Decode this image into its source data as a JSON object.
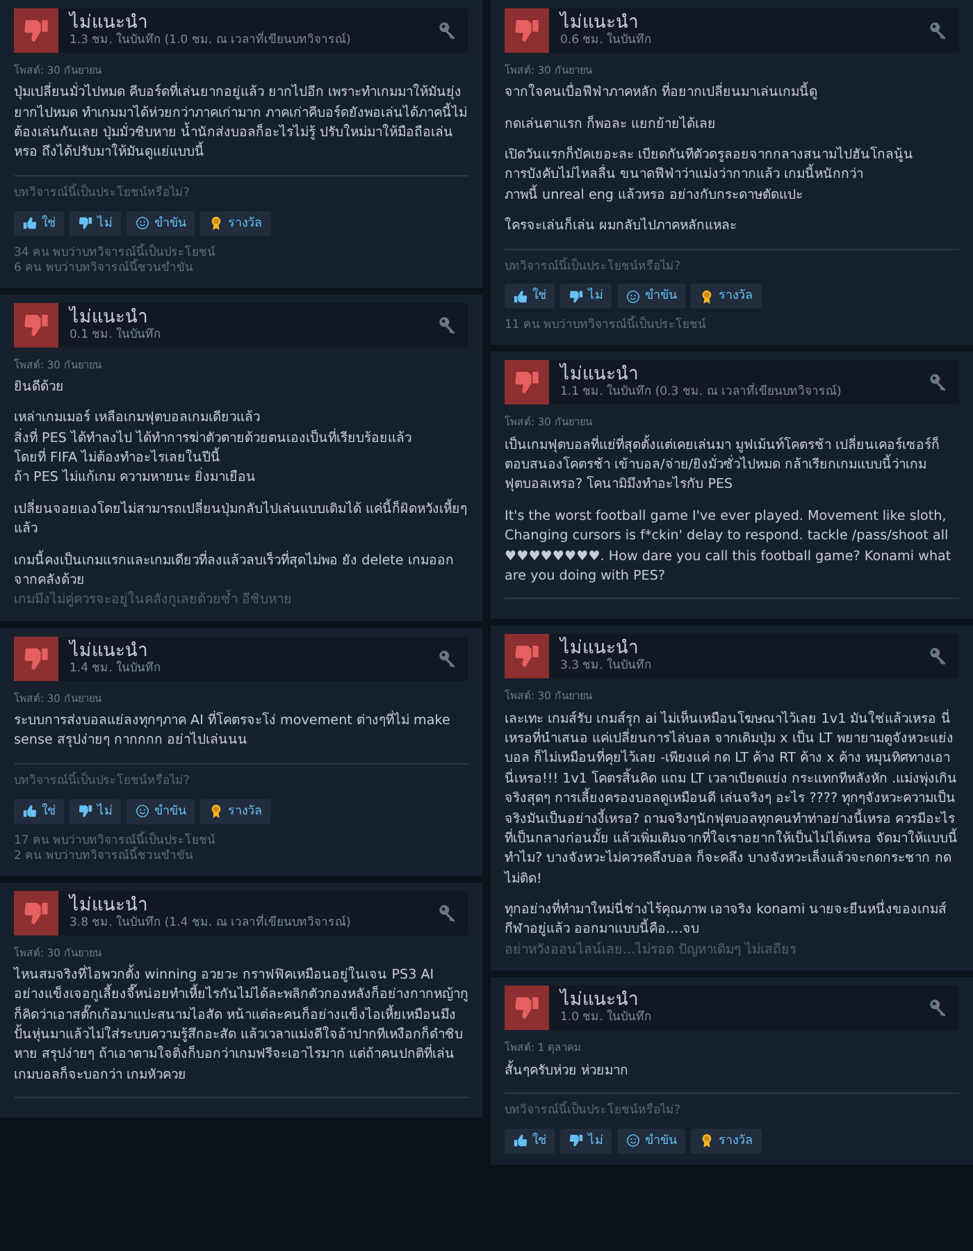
{
  "columns": [
    {
      "reviews": [
        {
          "title": "ไม่แนะนำ",
          "hours": "1.3 ชม. ในบันทึก (1.0 ชม. ณ เวลาที่เขียนบทวิจารณ์)",
          "posted": "โพสต์: 30 กันยายน",
          "paragraphs": [
            "ปุ่มเปลี่ยนมั่วไปหมด คีบอร์ดที่เล่นยากอยู่แล้ว ยากไปอีก เพราะทำเกมมาให้มันยุ่งยากไปหมด ทำเกมมาได้ห่วยกว่าภาคเก่ามาก ภาคเก่าคีบอร์ดยังพอเล่นได้ภาคนี้ไม่ต้องเล่นกันเลย ปุ่มมั่วชิบหาย น้ำนักส่งบอลก็อะไรไม่รู้ ปรับใหม่มาให้มือถือเล่นหรอ ถึงได้ปรับมาให้มันดูแย่แบบนี้"
          ],
          "prompt": "บทวิจารณ์นี้เป็นประโยชน์หรือไม่?",
          "buttons": [
            {
              "kind": "yes",
              "label": "ใช่"
            },
            {
              "kind": "no",
              "label": "ไม่"
            },
            {
              "kind": "funny",
              "label": "ขำขัน"
            },
            {
              "kind": "award",
              "label": "รางวัล"
            }
          ],
          "counts": [
            "34 คน พบว่าบทวิจารณ์นี้เป็นประโยชน์",
            "6 คน พบว่าบทวิจารณ์นี้ชวนขำขัน"
          ]
        },
        {
          "title": "ไม่แนะนำ",
          "hours": "0.1 ชม. ในบันทึก",
          "posted": "โพสต์: 30 กันยายน",
          "paragraphs": [
            "ยินดีด้วย",
            "เหล่าเกมเมอร์ เหลือเกมฟุตบอลเกมเดียวแล้ว\nสิ่งที่ PES ได้ทำลงไป ได้ทำการฆ่าตัวตายด้วยตนเองเป็นที่เรียบร้อยแล้ว\nโดยที่ FIFA ไม่ต้องทำอะไรเลยในปีนี้\nถ้า PES ไม่แก้เกม ความหายนะ ยิ่งมาเยือน",
            "เปลี่ยนจอยเองโดยไม่สามารถเปลี่ยนปุ่มกลับไปเล่นแบบเดิมได้ แค่นี้ก็ผิดหวังเหี้ยๆแล้ว",
            "เกมนี้คงเป็นเกมแรกและเกมเดียวที่ลงแล้วลบเร็วที่สุดไม่พอ ยัง delete เกมออกจากคลังด้วย"
          ],
          "faded": "เกมมึงไม่คู่ควรจะอยู่ในคลังกูเลยด้วยซ้ำ อีชิบหาย"
        },
        {
          "title": "ไม่แนะนำ",
          "hours": "1.4 ชม. ในบันทึก",
          "posted": "โพสต์: 30 กันยายน",
          "paragraphs": [
            "ระบบการส่งบอลแย่ลงทุกๆภาค AI ที่โคตรจะโง่ movement ต่างๆที่ไม่ make sense สรุปง่ายๆ กากกกก อย่าไปเล่นนน"
          ],
          "prompt": "บทวิจารณ์นี้เป็นประโยชน์หรือไม่?",
          "buttons": [
            {
              "kind": "yes",
              "label": "ใช่"
            },
            {
              "kind": "no",
              "label": "ไม่"
            },
            {
              "kind": "funny",
              "label": "ขำขัน"
            },
            {
              "kind": "award",
              "label": "รางวัล"
            }
          ],
          "counts": [
            "17 คน พบว่าบทวิจารณ์นี้เป็นประโยชน์",
            "2 คน พบว่าบทวิจารณ์นี้ชวนขำขัน"
          ]
        },
        {
          "title": "ไม่แนะนำ",
          "hours": "3.8 ชม. ในบันทึก (1.4 ชม. ณ เวลาที่เขียนบทวิจารณ์)",
          "posted": "โพสต์: 30 กันยายน",
          "paragraphs": [
            "ไหนสมจริงที่ไอพวกตั้ง winning อวยวะ กราฟฟิคเหมือนอยู่ในเจน PS3 AI อย่างแข็งเจอกูเลี้ยงจี๊หน่อยทำเหี้ยไรกันไม่ได้ละพลิกตัวกองหลังก็อย่างกากหญ้ากูก็คิดว่าเอาสตั๊กเก้อมาแปะสนามไอสัด หน้าแต่ละคนก็อย่างแข็งไอเหี้ยเหมือนมึงปั้นหุ่นมาแล้วไม่ใส่ระบบความรู้สึกอะสัด แล้วเวลาแม่งดีใจอ้าปากทีเหงือกก็ดำชิบหาย สรุปง่ายๆ ถ้าเอาตามใจติ่งก็บอกว่าเกมฟรีจะเอาไรมาก แต่ถ้าคนปกติที่เล่นเกมบอลก็จะบอกว่า เกมหัวควย"
          ]
        }
      ]
    },
    {
      "reviews": [
        {
          "title": "ไม่แนะนำ",
          "hours": "0.6 ชม. ในบันทึก",
          "posted": "โพสต์: 30 กันยายน",
          "paragraphs": [
            "จากใจคนเบื่อฟีฟ่าภาคหลัก ที่อยากเปลี่ยนมาเล่นเกมนี้ดู",
            "กดเล่นตาแรก ก็พอละ แยกย้ายได้เลย",
            "เปิดวันแรกก็บัคเยอะละ เบียดกันทีตัวดรูลอยจากกลางสนามไปฮันโกลนู้น\nการบังคับไม่ไหลลื่น ขนาดฟีฟ่าว่าแม่งว่ากากแล้ว เกมนี้หนักกว่า\nภาพนี้ unreal eng แล้วหรอ อย่างกับกระดาษตัดแปะ",
            "ใครจะเล่นก็เล่น ผมกลับไปภาคหลักแหละ"
          ],
          "prompt": "บทวิจารณ์นี้เป็นประโยชน์หรือไม่?",
          "buttons": [
            {
              "kind": "yes",
              "label": "ใช่"
            },
            {
              "kind": "no",
              "label": "ไม่"
            },
            {
              "kind": "funny",
              "label": "ขำขัน"
            },
            {
              "kind": "award",
              "label": "รางวัล"
            }
          ],
          "counts": [
            "11 คน พบว่าบทวิจารณ์นี้เป็นประโยชน์"
          ]
        },
        {
          "title": "ไม่แนะนำ",
          "hours": "1.1 ชม. ในบันทึก (0.3 ชม. ณ เวลาที่เขียนบทวิจารณ์)",
          "posted": "โพสต์: 30 กันยายน",
          "paragraphs": [
            "เป็นเกมฟุตบอลที่แย่ที่สุดตั้งแต่เคยเล่นมา มูฟเม้นท์โคตรช้า เปลี่ยนเคอร์เซอร์ก็ตอบสนองโคตรช้า เข้าบอล/จ่าย/ยิงมั่วซั่วไปหมด กล้าเรียกเกมแบบนี้ว่าเกมฟุตบอลเหรอ? โคนามิมึงทำอะไรกับ PES",
            "It's the worst football game I've ever played. Movement like sloth, Changing cursors is f*ckin' delay to respond. tackle /pass/shoot all ♥♥♥♥♥♥♥♥. How dare you call this football game? Konami what are you doing with PES?"
          ]
        },
        {
          "title": "ไม่แนะนำ",
          "hours": "3.3 ชม. ในบันทึก",
          "posted": "โพสต์: 30 กันยายน",
          "paragraphs": [
            "เละเทะ เกมส์รับ เกมส์รุก ai ไม่เห็นเหมือนโฆษณาไว้เลย 1v1 มันใช่แล้วเหรอ นี่เหรอที่นำเสนอ แค่เปลี่ยนการไล่บอล จากเดิมปุ่ม x เป็น LT พยายามดูจังหวะแย่งบอล ก็ไม่เหมือนที่คุยไว้เลย -เพียงแค่ กด LT ค้าง RT ค้าง x ค้าง หมุนทิศทางเอา นี่เหรอ!!! 1v1 โคตรสิ้นคิด แถม LT เวลาเบียดแย่ง กระแทกทีหลังหัก .แม่งพุ่งเกินจริงสุดๆ การเลี้ยงครองบอลดูเหมือนดี เล่นจริงๆ อะไร ???? ทุกๆจังหวะความเป็นจริงมันเป็นอย่างงี้เหรอ? ถามจริงๆนักฟุตบอลทุกคนทำท่าอย่างนี้เหรอ ควรมีอะไรที่เป็นกลางก่อนมั้ย แล้วเพิ่มเติมจากที่ใจเราอยากให้เป็นไม่ได้เหรอ จัดมาให้แบบนี้ทำไม? บางจังหวะไม่ควรคลึงบอล ก็จะคลึง บางจังหวะเล็งแล้วจะกดกระชาก กดไม่ติด!",
            "ทุกอย่างที่ทำมาใหม่นี่ช่างไร้คุณภาพ เอาจริง konami นายจะยืนหนึ่งของเกมส์กีฬาอยู่แล้ว ออกมาแบบนี้คือ....จบ"
          ],
          "faded": "อย่าหวังออนไลน์เลย...ไม่รอด ปัญหาเดิมๆ ไม่เสถียร"
        },
        {
          "title": "ไม่แนะนำ",
          "hours": "1.0 ชม. ในบันทึก",
          "posted": "โพสต์: 1 ตุลาคม",
          "paragraphs": [
            "สั้นๆครับห่วย ห่วยมาก"
          ],
          "prompt": "บทวิจารณ์นี้เป็นประโยชน์หรือไม่?",
          "buttons": [
            {
              "kind": "yes",
              "label": "ใช่"
            },
            {
              "kind": "no",
              "label": "ไม่"
            },
            {
              "kind": "funny",
              "label": "ขำขัน"
            },
            {
              "kind": "award",
              "label": "รางวัล"
            }
          ]
        }
      ]
    }
  ]
}
